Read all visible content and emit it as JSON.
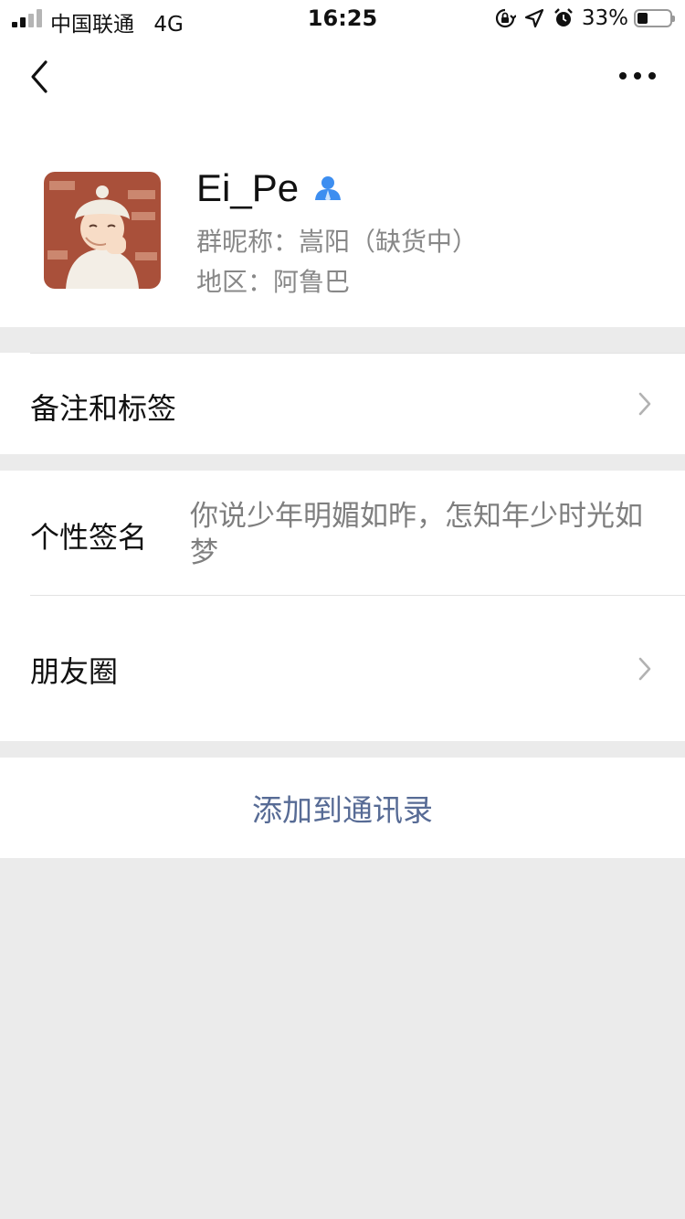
{
  "status_bar": {
    "carrier": "中国联通",
    "network": "4G",
    "time": "16:25",
    "battery_percent": "33%",
    "signal_bars_active": 2,
    "signal_bars_total": 4,
    "icons": [
      "orientation-lock-icon",
      "location-icon",
      "alarm-icon",
      "battery-icon"
    ]
  },
  "nav": {
    "back_icon": "chevron-left-icon",
    "more_icon": "more-dots-icon"
  },
  "profile": {
    "nickname": "Ei_Pe",
    "group_nickname_line": "群昵称：嵩阳（缺货中）",
    "region_line": "地区：阿鲁巴",
    "contact_icon": "contact-person-icon",
    "contact_icon_color": "#3d8ef0"
  },
  "rows": {
    "remarks_tags": "备注和标签",
    "signature_label": "个性签名",
    "signature_value": "你说少年明媚如昨，怎知年少时光如梦",
    "moments": "朋友圈"
  },
  "actions": {
    "add_to_contacts": "添加到通讯录"
  },
  "colors": {
    "link": "#576b95",
    "background": "#ebebeb",
    "secondary_text": "#888888"
  }
}
